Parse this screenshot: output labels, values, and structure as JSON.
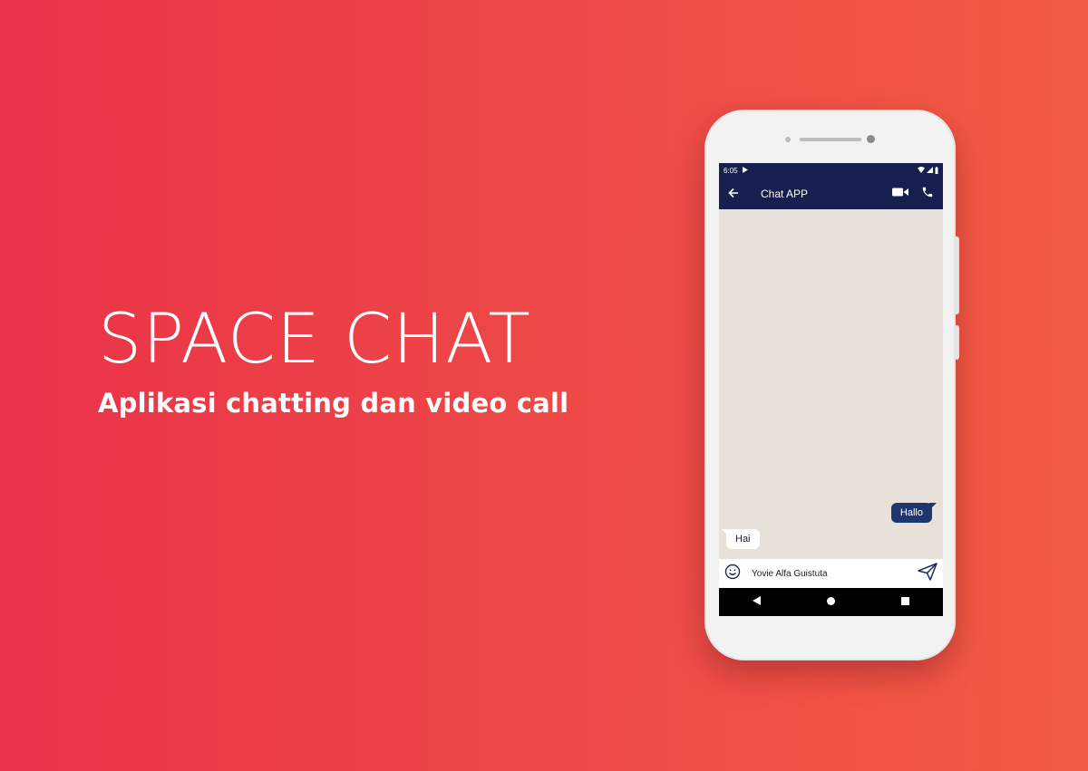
{
  "hero": {
    "title": "SPACE CHAT",
    "subtitle": "Aplikasi chatting dan video call"
  },
  "phone": {
    "status_bar": {
      "time": "6:05",
      "icons": [
        "play-icon",
        "wifi-icon",
        "signal-icon",
        "battery-icon"
      ]
    },
    "app_bar": {
      "title": "Chat APP",
      "icons": [
        "back-arrow-icon",
        "video-camera-icon",
        "phone-icon"
      ]
    },
    "messages": [
      {
        "direction": "outgoing",
        "text": "Hallo"
      },
      {
        "direction": "incoming",
        "text": "Hai"
      }
    ],
    "input": {
      "value": "Yovie Alfa Guistuta",
      "icons": [
        "emoji-icon",
        "send-icon"
      ]
    },
    "nav_bar": {
      "icons": [
        "nav-back-icon",
        "nav-home-icon",
        "nav-recents-icon"
      ]
    }
  },
  "colors": {
    "background_left": "#ea3349",
    "background_right": "#f25c44",
    "app_bar": "#161f4d",
    "outgoing_bubble": "#1e3570",
    "chat_background": "#e8e1d9"
  }
}
